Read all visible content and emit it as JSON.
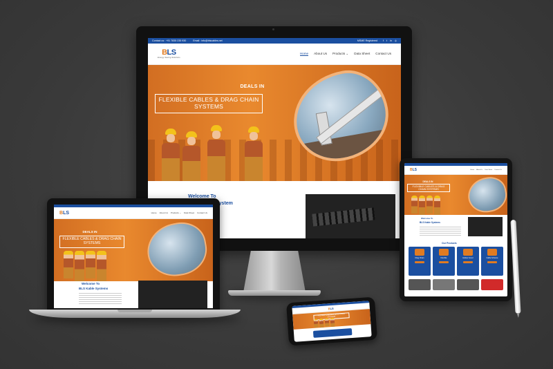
{
  "site": {
    "topbar": {
      "contact": "Contact us : +91 7835 235 930",
      "email": "Email : info@blscables.net",
      "badge": "MSME Registered"
    },
    "logo": {
      "mark_a": "B",
      "mark_b": "LS",
      "tagline": "Energy Saving Solutions"
    },
    "nav": [
      "Home",
      "About Us",
      "Products ⌄",
      "Data Sheet",
      "Contact Us"
    ],
    "hero": {
      "deals": "DEALS IN",
      "products": "FLEXIBLE CABLES & DRAG CHAIN SYSTEMS"
    },
    "welcome": "Welcome To",
    "system": "System",
    "laptop_welcome": "Welcome To",
    "laptop_company": "BLS Kable Systems",
    "our_products": "Our Products",
    "cards": [
      "Drag Chain",
      "Flexible",
      "Hollow Cover",
      "Cable Scheme"
    ]
  },
  "colors": {
    "brand_blue": "#1b4fa0",
    "brand_orange": "#e07b22",
    "background": "#3c3c3c"
  },
  "icons": [
    "facebook-icon",
    "twitter-icon",
    "linkedin-icon",
    "instagram-icon"
  ]
}
